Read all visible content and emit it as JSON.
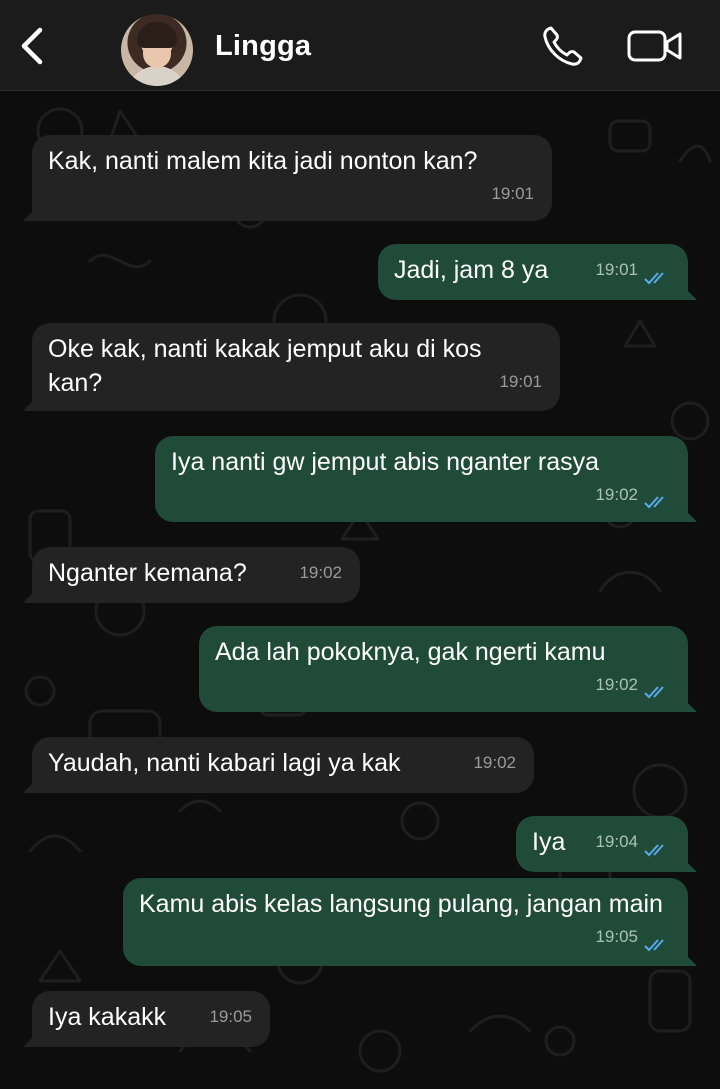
{
  "header": {
    "contact_name": "Lingga",
    "back_icon": "chevron-left-icon",
    "call_icon": "phone-icon",
    "video_icon": "video-camera-icon"
  },
  "colors": {
    "incoming_bubble": "#232323",
    "outgoing_bubble": "#1f4b38",
    "read_ticks": "#5aa9ea",
    "header_bg": "#1b1b1b"
  },
  "messages": [
    {
      "direction": "in",
      "text": "Kak, nanti malem kita jadi nonton kan?",
      "time": "19:01"
    },
    {
      "direction": "out",
      "text": "Jadi, jam 8 ya",
      "time": "19:01",
      "status": "read"
    },
    {
      "direction": "in",
      "text": "Oke kak, nanti kakak jemput aku di kos kan?",
      "time": "19:01"
    },
    {
      "direction": "out",
      "text": "Iya nanti gw jemput abis nganter rasya",
      "time": "19:02",
      "status": "read"
    },
    {
      "direction": "in",
      "text": "Nganter kemana?",
      "time": "19:02"
    },
    {
      "direction": "out",
      "text": "Ada lah pokoknya, gak ngerti kamu",
      "time": "19:02",
      "status": "read"
    },
    {
      "direction": "in",
      "text": "Yaudah, nanti kabari lagi ya kak",
      "time": "19:02"
    },
    {
      "direction": "out",
      "text": "Iya",
      "time": "19:04",
      "status": "read"
    },
    {
      "direction": "out",
      "text": "Kamu abis kelas langsung pulang, jangan main",
      "time": "19:05",
      "status": "read"
    },
    {
      "direction": "in",
      "text": "Iya kakakk",
      "time": "19:05"
    }
  ]
}
